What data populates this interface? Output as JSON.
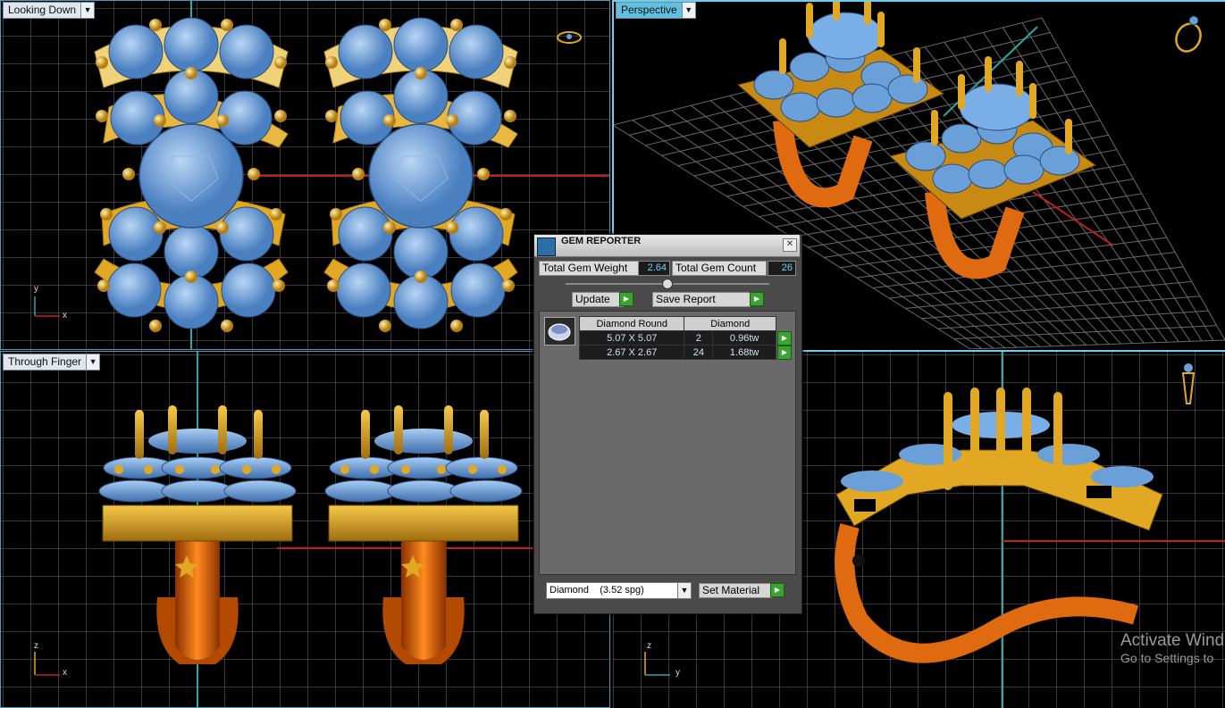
{
  "viewports": {
    "top_left": {
      "label": "Looking Down",
      "axis_h": "x",
      "axis_v": "y"
    },
    "top_right": {
      "label": "Perspective"
    },
    "bottom_left": {
      "label": "Through Finger",
      "axis_h": "x",
      "axis_v": "z"
    },
    "bottom_right": {
      "axis_h": "y",
      "axis_v": "z"
    }
  },
  "gem_reporter": {
    "title": "GEM REPORTER",
    "close_symbol": "✕",
    "total_weight_label": "Total Gem Weight",
    "total_weight_value": "2.64",
    "total_count_label": "Total Gem Count",
    "total_count_value": "26",
    "update_label": "Update",
    "save_label": "Save Report",
    "table": {
      "headers": [
        "Diamond Round",
        "Diamond"
      ],
      "rows": [
        {
          "size": "5.07 X 5.07",
          "count": "2",
          "weight": "0.96tw"
        },
        {
          "size": "2.67 X 2.67",
          "count": "24",
          "weight": "1.68tw"
        }
      ]
    },
    "material_select": "Diamond    (3.52 spg)",
    "set_material_label": "Set Material"
  },
  "watermark": {
    "line1": "Activate Wind",
    "line2": "Go to Settings to"
  },
  "colors": {
    "grid": "#6e6e6e",
    "gold": "#e2a824",
    "gem": "#6a9fd8",
    "shank": "#e06a10",
    "accent": "#5fc0e0"
  }
}
